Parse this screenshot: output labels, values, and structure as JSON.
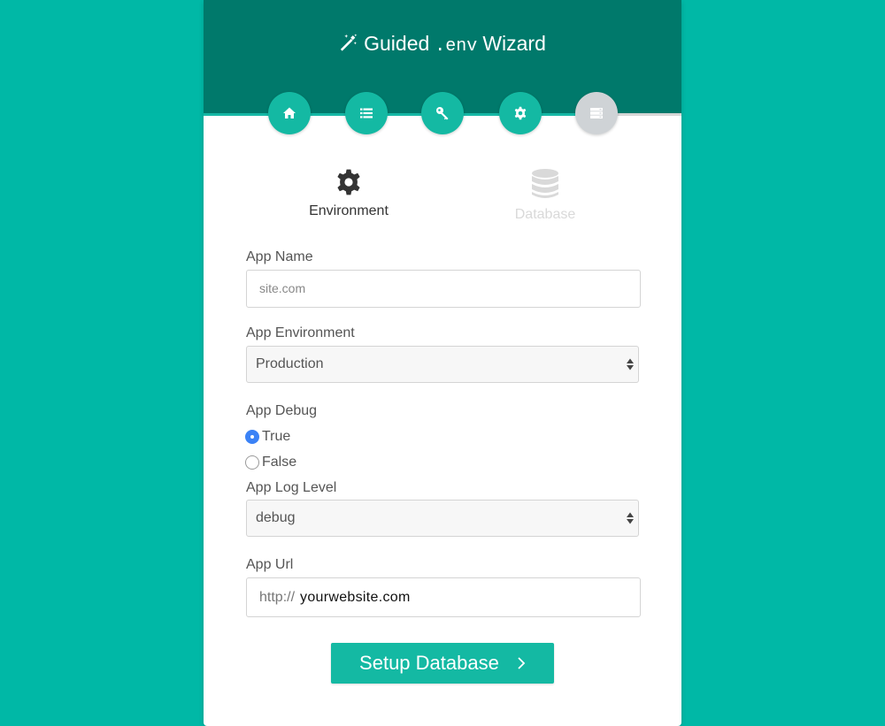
{
  "header": {
    "title_prefix": "Guided",
    "title_code": ".env",
    "title_suffix": "Wizard",
    "title_icon": "magic-wand-icon"
  },
  "steps": [
    {
      "icon": "home-icon",
      "state": "complete"
    },
    {
      "icon": "list-icon",
      "state": "complete"
    },
    {
      "icon": "key-icon",
      "state": "complete"
    },
    {
      "icon": "gear-icon",
      "state": "complete"
    },
    {
      "icon": "server-icon",
      "state": "inactive"
    }
  ],
  "tabs": [
    {
      "label": "Environment",
      "icon": "gear-icon",
      "active": true
    },
    {
      "label": "Database",
      "icon": "database-icon",
      "active": false
    }
  ],
  "form": {
    "app_name_label": "App Name",
    "app_name_placeholder": "site.com",
    "app_env_label": "App Environment",
    "app_env_value": "Production",
    "app_debug_label": "App Debug",
    "debug_true_label": "True",
    "debug_false_label": "False",
    "debug_selected": "True",
    "log_level_label": "App Log Level",
    "log_level_value": "debug",
    "app_url_label": "App Url",
    "app_url_prefix": "http://",
    "app_url_value": "yourwebsite.com"
  },
  "actions": {
    "setup_database_label": "Setup Database"
  },
  "colors": {
    "background": "#00b8a6",
    "header": "#00796b",
    "accent": "#14b9a3",
    "inactive_step": "#cfd3d6",
    "radio_checked": "#3b82f6"
  }
}
